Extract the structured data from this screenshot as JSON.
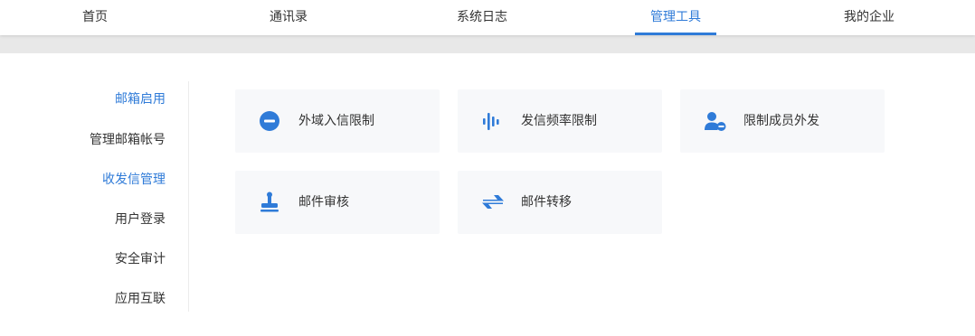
{
  "topnav": {
    "tabs": [
      {
        "label": "首页"
      },
      {
        "label": "通讯录"
      },
      {
        "label": "系统日志"
      },
      {
        "label": "管理工具"
      },
      {
        "label": "我的企业"
      }
    ],
    "active_index": 3
  },
  "sidebar": {
    "items": [
      {
        "label": "邮箱启用",
        "highlighted": true
      },
      {
        "label": "管理邮箱帐号",
        "highlighted": false
      },
      {
        "label": "收发信管理",
        "highlighted": true
      },
      {
        "label": "用户登录",
        "highlighted": false
      },
      {
        "label": "安全审计",
        "highlighted": false
      },
      {
        "label": "应用互联",
        "highlighted": false
      }
    ]
  },
  "tools": [
    {
      "label": "外域入信限制",
      "icon": "minus-circle-icon"
    },
    {
      "label": "发信频率限制",
      "icon": "frequency-bars-icon"
    },
    {
      "label": "限制成员外发",
      "icon": "user-minus-icon"
    },
    {
      "label": "邮件审核",
      "icon": "stamp-icon"
    },
    {
      "label": "邮件转移",
      "icon": "transfer-arrows-icon"
    }
  ],
  "colors": {
    "accent": "#2f7bd8",
    "card_bg": "#f7f8fa",
    "band_gray": "#e8e8e8"
  }
}
